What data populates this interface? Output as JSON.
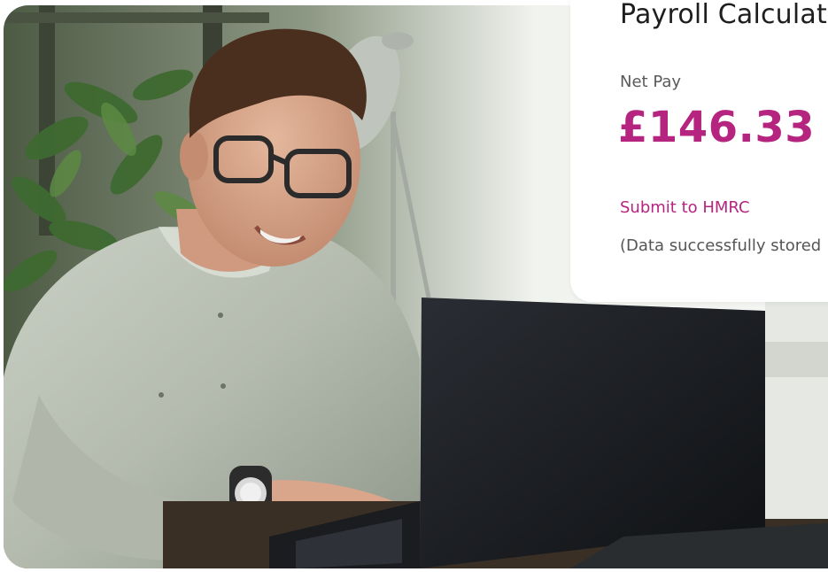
{
  "card": {
    "title": "Payroll Calculat",
    "net_label": "Net Pay",
    "net_value": "£146.33",
    "submit_label": "Submit to HMRC",
    "status": "(Data successfully stored"
  },
  "photo": {
    "subject": "smiling-man-using-laptop"
  },
  "colors": {
    "accent": "#b5247f",
    "title": "#1e1e1e",
    "muted": "#5a5a5a"
  }
}
